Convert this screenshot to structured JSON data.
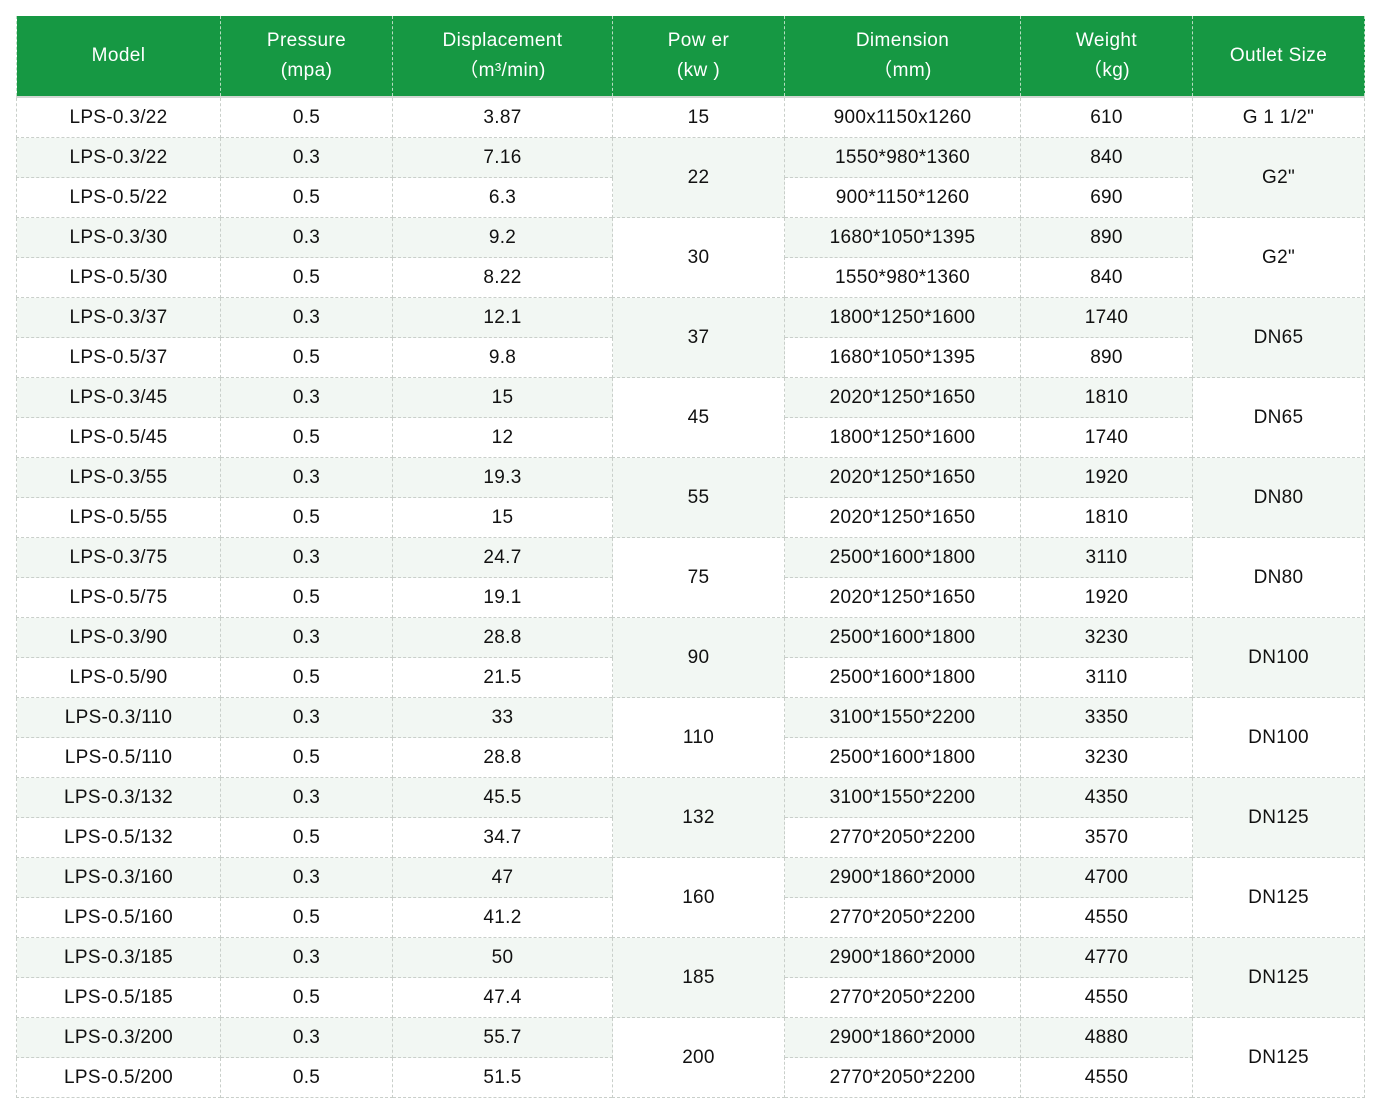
{
  "header": {
    "model": "Model",
    "pressure": "Pressure",
    "pressure_unit": "(mpa)",
    "displacement": "Displacement",
    "displacement_unit": "（m³/min)",
    "power": "Pow er",
    "power_unit": "(kw )",
    "dimension": "Dimension",
    "dimension_unit": "（mm)",
    "weight": "Weight",
    "weight_unit": "（kg)",
    "outlet": "Outlet Size"
  },
  "rows": [
    {
      "model": "LPS-0.3/22",
      "pressure": "0.5",
      "displacement": "3.87",
      "dimension": "900x1150x1260",
      "weight": "610"
    },
    {
      "model": "LPS-0.3/22",
      "pressure": "0.3",
      "displacement": "7.16",
      "dimension": "1550*980*1360",
      "weight": "840"
    },
    {
      "model": "LPS-0.5/22",
      "pressure": "0.5",
      "displacement": "6.3",
      "dimension": "900*1150*1260",
      "weight": "690"
    },
    {
      "model": "LPS-0.3/30",
      "pressure": "0.3",
      "displacement": "9.2",
      "dimension": "1680*1050*1395",
      "weight": "890"
    },
    {
      "model": "LPS-0.5/30",
      "pressure": "0.5",
      "displacement": "8.22",
      "dimension": "1550*980*1360",
      "weight": "840"
    },
    {
      "model": "LPS-0.3/37",
      "pressure": "0.3",
      "displacement": "12.1",
      "dimension": "1800*1250*1600",
      "weight": "1740"
    },
    {
      "model": "LPS-0.5/37",
      "pressure": "0.5",
      "displacement": "9.8",
      "dimension": "1680*1050*1395",
      "weight": "890"
    },
    {
      "model": "LPS-0.3/45",
      "pressure": "0.3",
      "displacement": "15",
      "dimension": "2020*1250*1650",
      "weight": "1810"
    },
    {
      "model": "LPS-0.5/45",
      "pressure": "0.5",
      "displacement": "12",
      "dimension": "1800*1250*1600",
      "weight": "1740"
    },
    {
      "model": "LPS-0.3/55",
      "pressure": "0.3",
      "displacement": "19.3",
      "dimension": "2020*1250*1650",
      "weight": "1920"
    },
    {
      "model": "LPS-0.5/55",
      "pressure": "0.5",
      "displacement": "15",
      "dimension": "2020*1250*1650",
      "weight": "1810"
    },
    {
      "model": "LPS-0.3/75",
      "pressure": "0.3",
      "displacement": "24.7",
      "dimension": "2500*1600*1800",
      "weight": "3110"
    },
    {
      "model": "LPS-0.5/75",
      "pressure": "0.5",
      "displacement": "19.1",
      "dimension": "2020*1250*1650",
      "weight": "1920"
    },
    {
      "model": "LPS-0.3/90",
      "pressure": "0.3",
      "displacement": "28.8",
      "dimension": "2500*1600*1800",
      "weight": "3230"
    },
    {
      "model": "LPS-0.5/90",
      "pressure": "0.5",
      "displacement": "21.5",
      "dimension": "2500*1600*1800",
      "weight": "3110"
    },
    {
      "model": "LPS-0.3/110",
      "pressure": "0.3",
      "displacement": "33",
      "dimension": "3100*1550*2200",
      "weight": "3350"
    },
    {
      "model": "LPS-0.5/110",
      "pressure": "0.5",
      "displacement": "28.8",
      "dimension": "2500*1600*1800",
      "weight": "3230"
    },
    {
      "model": "LPS-0.3/132",
      "pressure": "0.3",
      "displacement": "45.5",
      "dimension": "3100*1550*2200",
      "weight": "4350"
    },
    {
      "model": "LPS-0.5/132",
      "pressure": "0.5",
      "displacement": "34.7",
      "dimension": "2770*2050*2200",
      "weight": "3570"
    },
    {
      "model": "LPS-0.3/160",
      "pressure": "0.3",
      "displacement": "47",
      "dimension": "2900*1860*2000",
      "weight": "4700"
    },
    {
      "model": "LPS-0.5/160",
      "pressure": "0.5",
      "displacement": "41.2",
      "dimension": "2770*2050*2200",
      "weight": "4550"
    },
    {
      "model": "LPS-0.3/185",
      "pressure": "0.3",
      "displacement": "50",
      "dimension": "2900*1860*2000",
      "weight": "4770"
    },
    {
      "model": "LPS-0.5/185",
      "pressure": "0.5",
      "displacement": "47.4",
      "dimension": "2770*2050*2200",
      "weight": "4550"
    },
    {
      "model": "LPS-0.3/200",
      "pressure": "0.3",
      "displacement": "55.7",
      "dimension": "2900*1860*2000",
      "weight": "4880"
    },
    {
      "model": "LPS-0.5/200",
      "pressure": "0.5",
      "displacement": "51.5",
      "dimension": "2770*2050*2200",
      "weight": "4550"
    }
  ],
  "groups": [
    {
      "power": "15",
      "outlet": "G 1 1/2\""
    },
    {
      "power": "22",
      "outlet": "G2\""
    },
    {
      "power": "30",
      "outlet": "G2\""
    },
    {
      "power": "37",
      "outlet": "DN65"
    },
    {
      "power": "45",
      "outlet": "DN65"
    },
    {
      "power": "55",
      "outlet": "DN80"
    },
    {
      "power": "75",
      "outlet": "DN80"
    },
    {
      "power": "90",
      "outlet": "DN100"
    },
    {
      "power": "110",
      "outlet": "DN100"
    },
    {
      "power": "132",
      "outlet": "DN125"
    },
    {
      "power": "160",
      "outlet": "DN125"
    },
    {
      "power": "185",
      "outlet": "DN125"
    },
    {
      "power": "200",
      "outlet": "DN125"
    }
  ]
}
